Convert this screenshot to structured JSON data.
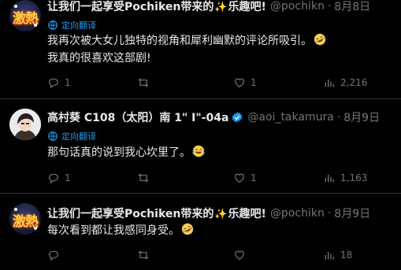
{
  "posts": [
    {
      "display_name": "让我们一起享受Pochiken带来的",
      "display_name_suffix": "乐趣吧!",
      "sparkle_glyph": "✨",
      "handle": "@pochikn",
      "separator": "·",
      "date": "8月8日",
      "translate_label": "定向翻译",
      "lines": [
        "我再次被大女儿独特的视角和犀利幽默的评论所吸引。",
        "我真的很喜欢这部剧!"
      ],
      "emoji": "rofl",
      "replies": "1",
      "reposts": "",
      "likes": "1",
      "views": "2,216",
      "avatar_text": "激熱"
    },
    {
      "display_name": "高村葵 C108（太阳）南 1\" I\"-04a",
      "handle": "@aoi_takamura",
      "separator": "·",
      "date": "8月9日",
      "translate_label": "定向翻译",
      "lines": [
        "那句话真的说到我心坎里了。"
      ],
      "emoji": "joy",
      "replies": "1",
      "reposts": "",
      "likes": "1",
      "views": "1,163"
    },
    {
      "display_name": "让我们一起享受Pochiken带来的",
      "display_name_suffix": "乐趣吧!",
      "sparkle_glyph": "✨",
      "handle": "@pochikn",
      "separator": "·",
      "date": "8月9日",
      "lines": [
        "每次看到都让我感同身受。"
      ],
      "emoji": "rofl",
      "replies": "",
      "reposts": "",
      "likes": "",
      "views": "18",
      "avatar_text": "激熱"
    }
  ],
  "colors": {
    "background": "#000000",
    "text": "#e7e9ea",
    "muted": "#71767b",
    "accent": "#1d9bf0",
    "divider": "#2f3336"
  },
  "icons": [
    "reply-icon",
    "repost-icon",
    "like-icon",
    "views-icon",
    "translate-icon",
    "verified-badge-icon"
  ]
}
